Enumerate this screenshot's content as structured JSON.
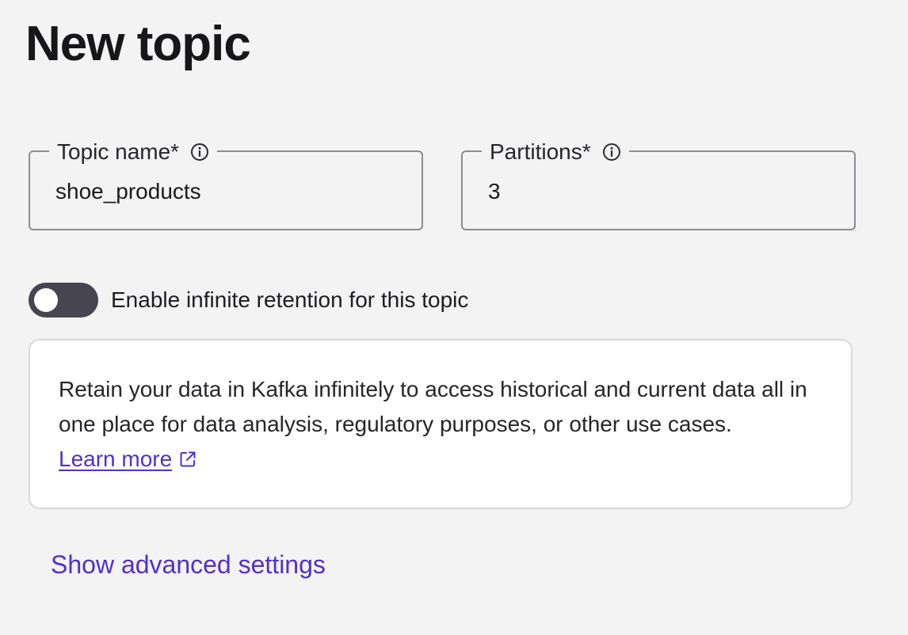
{
  "page": {
    "title": "New topic"
  },
  "form": {
    "topic_name": {
      "label": "Topic name*",
      "value": "shoe_products",
      "info_icon": "info-icon"
    },
    "partitions": {
      "label": "Partitions*",
      "value": "3",
      "info_icon": "info-icon"
    }
  },
  "retention": {
    "toggle_label": "Enable infinite retention for this topic",
    "enabled": false,
    "description": "Retain your data in Kafka infinitely to access historical and current data all in one place for data analysis, regulatory purposes, or other use cases.",
    "learn_more_label": "Learn more",
    "learn_more_icon": "external-link-icon"
  },
  "advanced": {
    "label": "Show advanced settings"
  },
  "colors": {
    "background": "#f3f3f3",
    "link": "#5230cc",
    "toggle_off": "#464550",
    "field_border": "#8d8c95"
  }
}
